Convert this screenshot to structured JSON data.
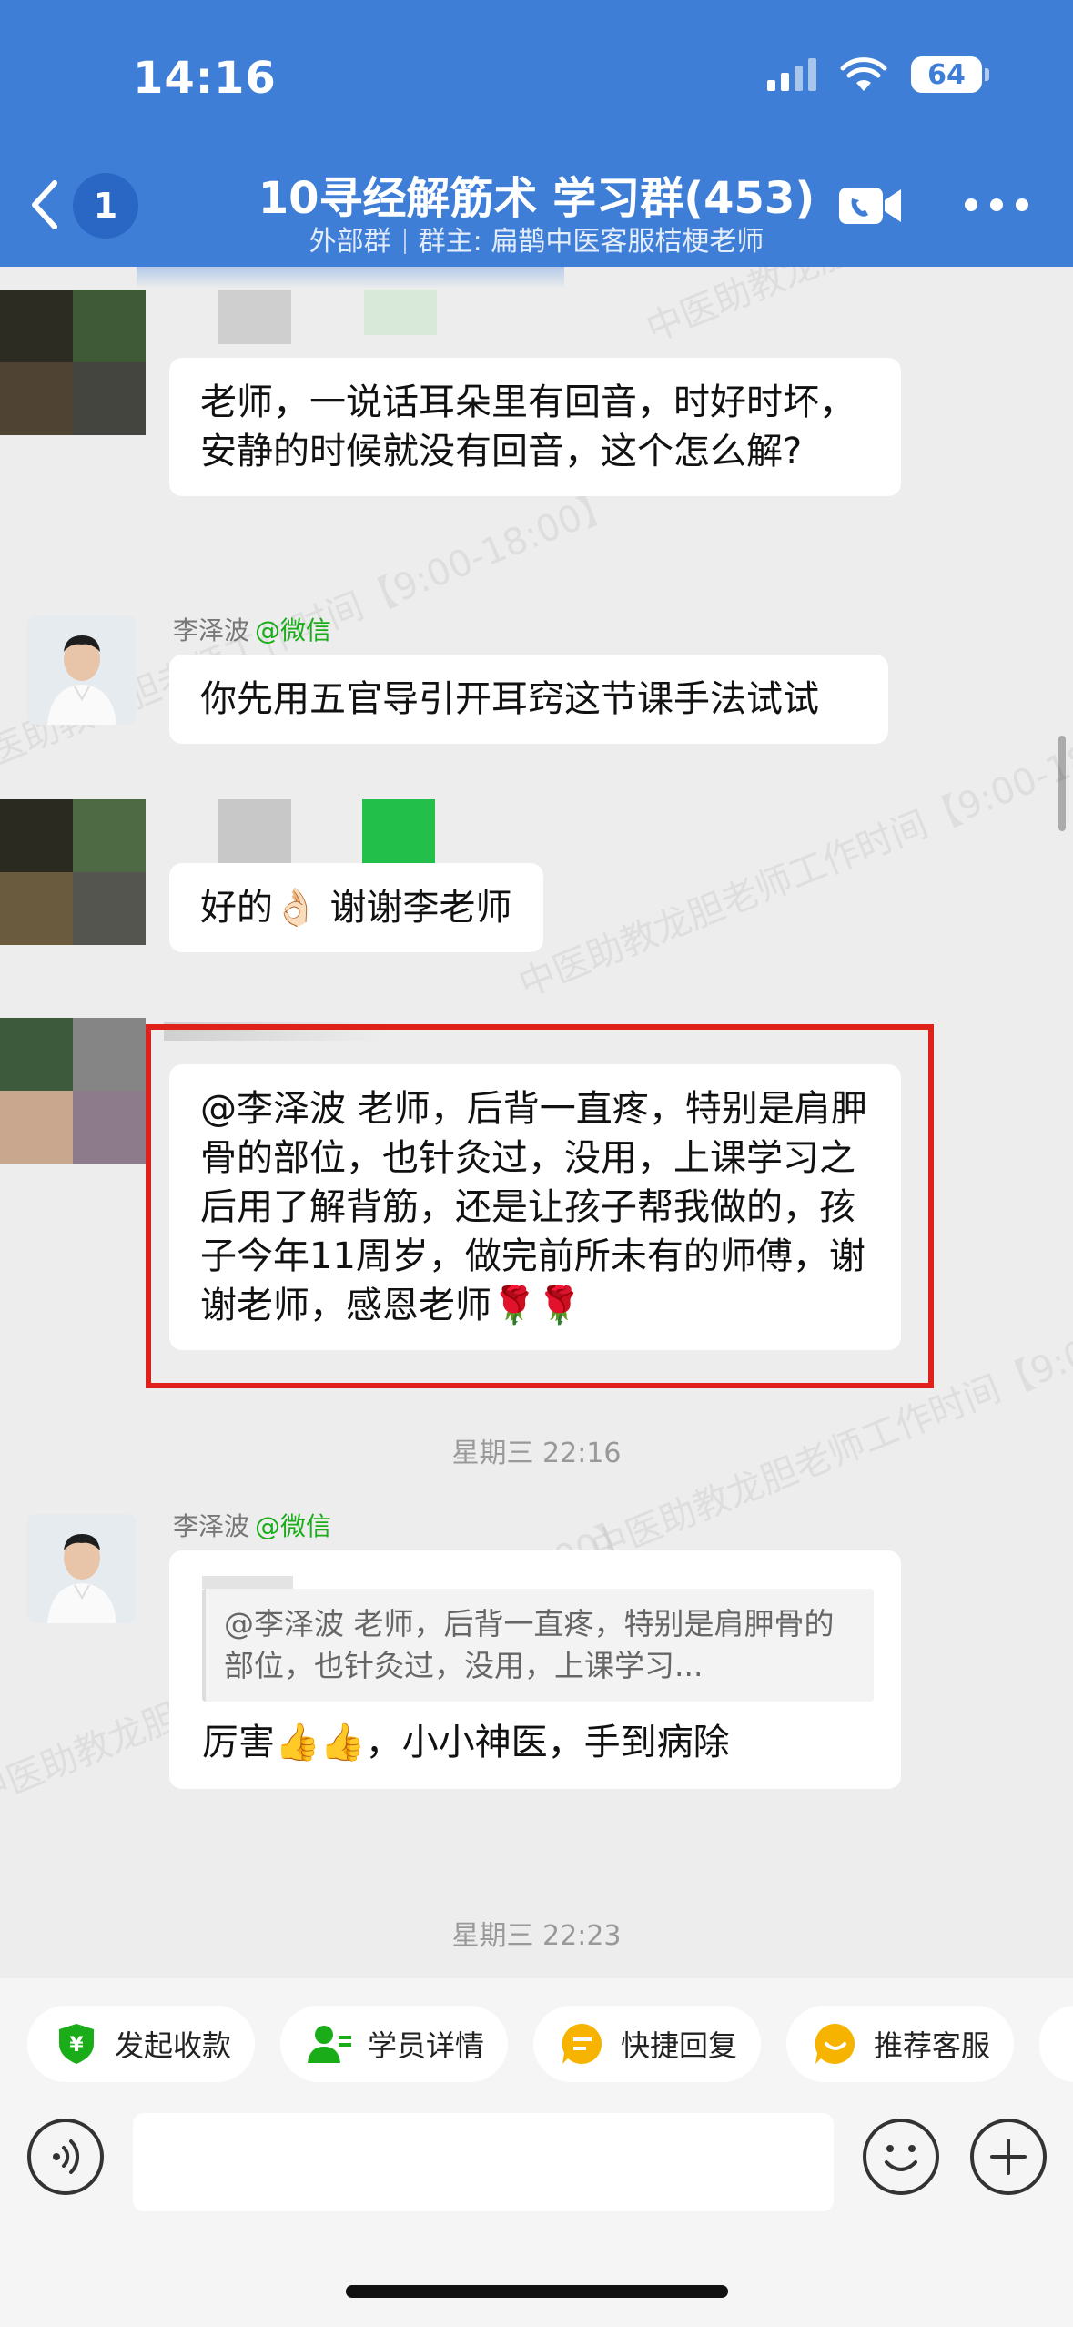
{
  "status_bar": {
    "time": "14:16",
    "battery": "64"
  },
  "header": {
    "unread_count": "1",
    "title": "10寻经解筋术 学习群(453)",
    "subtitle_tag": "外部群",
    "subtitle_owner": "群主: 扁鹊中医客服桔梗老师"
  },
  "messages": [
    {
      "text": "老师，一说话耳朵里有回音，时好时坏，安静的时候就没有回音，这个怎么解?"
    },
    {
      "sender": "李泽波",
      "sender_tag": "@微信",
      "text": "你先用五官导引开耳窍这节课手法试试"
    },
    {
      "text": "好的👌🏻 谢谢李老师"
    },
    {
      "text": "@李泽波 老师，后背一直疼，特别是肩胛骨的部位，也针灸过，没用，上课学习之后用了解背筋，还是让孩子帮我做的，孩子今年11周岁，做完前所未有的师傅，谢谢老师，感恩老师🌹🌹"
    },
    {
      "sender": "李泽波",
      "sender_tag": "@微信",
      "quote": "@李泽波 老师，后背一直疼，特别是肩胛骨的部位，也针灸过，没用，上课学习...",
      "text": "厉害👍👍，小小神医，手到病除"
    }
  ],
  "timestamps": [
    "星期三 22:16",
    "星期三 22:23"
  ],
  "watermark": "中医助教龙胆老师工作时间【9:00-18:00】",
  "quick_actions": [
    "发起收款",
    "学员详情",
    "快捷回复",
    "推荐客服"
  ],
  "input": {
    "placeholder": ""
  },
  "colors": {
    "header": "#3f7ed6",
    "highlight": "#e0201b",
    "wechat_tag": "#1aad19"
  }
}
